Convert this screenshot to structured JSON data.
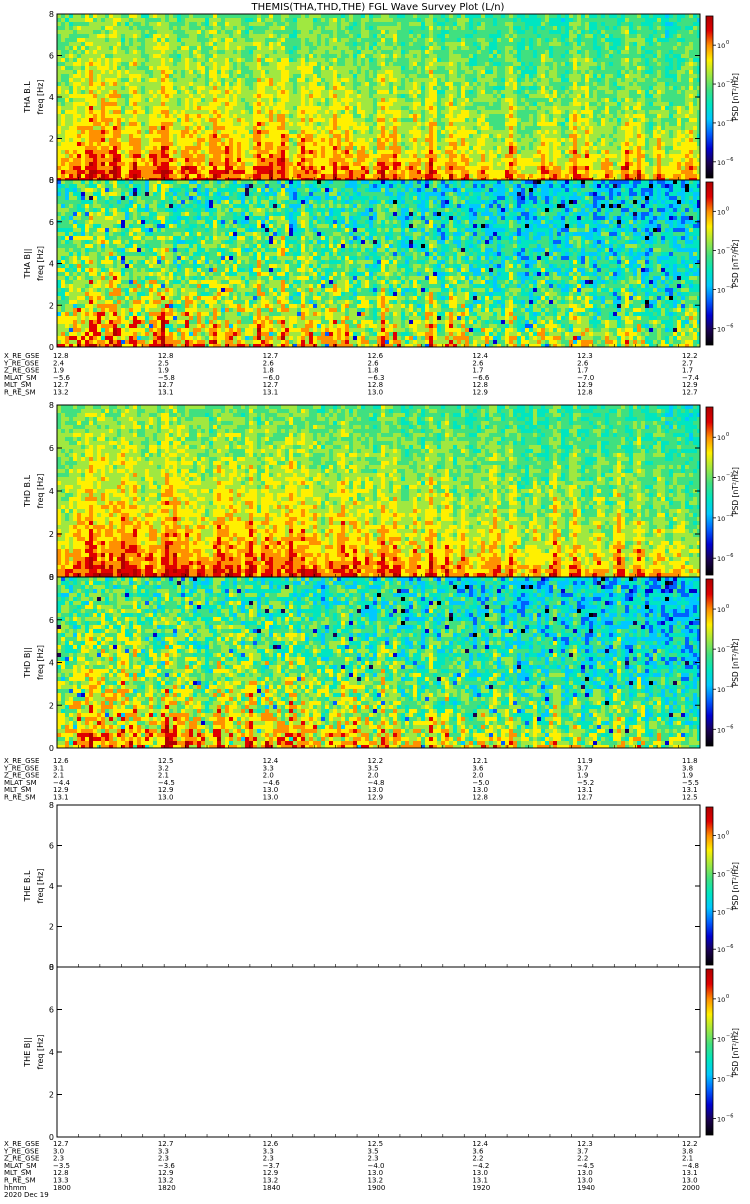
{
  "title": "THEMIS(THA,THD,THE) FGL Wave Survey Plot (L/n)",
  "cbar_tick_labels": [
    "10",
    "10",
    "10",
    "10"
  ],
  "cbar_tick_exps": [
    "0",
    "−2",
    "−4",
    "−6"
  ],
  "colors": {
    "colormap": [
      "#000000",
      "#1a0050",
      "#0000d0",
      "#0060ff",
      "#00c8ff",
      "#00e6c0",
      "#40e080",
      "#a0e840",
      "#fff000",
      "#ff9000",
      "#e00000",
      "#b00000"
    ]
  },
  "chart_data": [
    {
      "type": "heatmap",
      "probe": "THA",
      "component": "B.L",
      "ylabel": "THA B.L",
      "ysublabel": "freq [Hz]",
      "ylim": [
        0,
        8
      ],
      "yticks": [
        "0",
        "2",
        "4",
        "6",
        "8"
      ],
      "cbar_label": "PSD [nT²/Hz]",
      "has_data": true,
      "bands": [
        0.03,
        0.05,
        0.07,
        0.06,
        0.09,
        0.12,
        0.15,
        0.16,
        0.17,
        0.2,
        0.22,
        0.24,
        0.26,
        0.28,
        0.31,
        0.33,
        0.34,
        0.35,
        0.38,
        0.39,
        0.41,
        0.43,
        0.45,
        0.47,
        0.5,
        0.52,
        0.55,
        0.58,
        0.61,
        0.63,
        0.66,
        0.7,
        0.75,
        0.77,
        0.8,
        0.82,
        0.85,
        0.88,
        0.9,
        0.93,
        0.96,
        0.98
      ]
    },
    {
      "type": "heatmap",
      "probe": "THA",
      "component": "B||",
      "ylabel": "THA B||",
      "ysublabel": "freq [Hz]",
      "ylim": [
        0,
        8
      ],
      "yticks": [
        "0",
        "2",
        "4",
        "6",
        "8"
      ],
      "cbar_label": "PSD [nT²/Hz]",
      "has_data": true,
      "bands": [
        0.03,
        0.05,
        0.07,
        0.06,
        0.09,
        0.12,
        0.15,
        0.16,
        0.17,
        0.2,
        0.22,
        0.24,
        0.26,
        0.28,
        0.31,
        0.33,
        0.34,
        0.35,
        0.38,
        0.39,
        0.41,
        0.43,
        0.45,
        0.47,
        0.5,
        0.52,
        0.55,
        0.58,
        0.61,
        0.63,
        0.66,
        0.7,
        0.75,
        0.77,
        0.8,
        0.82,
        0.85,
        0.88,
        0.9,
        0.93,
        0.96,
        0.98
      ]
    },
    {
      "type": "heatmap",
      "probe": "THD",
      "component": "B.L",
      "ylabel": "THD B.L",
      "ysublabel": "freq [Hz]",
      "ylim": [
        0,
        8
      ],
      "yticks": [
        "0",
        "2",
        "4",
        "6",
        "8"
      ],
      "cbar_label": "PSD [nT²/Hz]",
      "has_data": true,
      "bands": [
        0.03,
        0.05,
        0.07,
        0.08,
        0.1,
        0.12,
        0.14,
        0.17,
        0.18,
        0.2,
        0.22,
        0.25,
        0.27,
        0.28,
        0.3,
        0.32,
        0.34,
        0.36,
        0.38,
        0.4,
        0.42,
        0.44,
        0.46,
        0.48,
        0.5,
        0.52,
        0.55,
        0.58,
        0.6,
        0.63,
        0.66,
        0.68,
        0.7,
        0.74,
        0.77,
        0.8,
        0.84,
        0.87,
        0.9,
        0.93,
        0.96
      ]
    },
    {
      "type": "heatmap",
      "probe": "THD",
      "component": "B||",
      "ylabel": "THD B||",
      "ysublabel": "freq [Hz]",
      "ylim": [
        0,
        8
      ],
      "yticks": [
        "0",
        "2",
        "4",
        "6",
        "8"
      ],
      "cbar_label": "PSD [nT²/Hz]",
      "has_data": true,
      "bands": [
        0.03,
        0.05,
        0.07,
        0.08,
        0.1,
        0.12,
        0.14,
        0.17,
        0.18,
        0.2,
        0.22,
        0.25,
        0.27,
        0.28,
        0.3,
        0.32,
        0.34,
        0.36,
        0.38,
        0.4,
        0.42,
        0.44,
        0.46,
        0.48,
        0.5,
        0.52,
        0.55,
        0.58,
        0.6,
        0.63,
        0.66,
        0.68,
        0.7,
        0.74,
        0.77,
        0.8,
        0.84,
        0.87,
        0.9,
        0.93,
        0.96
      ]
    },
    {
      "type": "heatmap",
      "probe": "THE",
      "component": "B.L",
      "ylabel": "THE B.L",
      "ysublabel": "freq [Hz]",
      "ylim": [
        0,
        8
      ],
      "yticks": [
        "0",
        "2",
        "4",
        "6",
        "8"
      ],
      "cbar_label": "PSD [nT²/Hz]",
      "has_data": false,
      "bands": []
    },
    {
      "type": "heatmap",
      "probe": "THE",
      "component": "B||",
      "ylabel": "THE B||",
      "ysublabel": "freq [Hz]",
      "ylim": [
        0,
        8
      ],
      "yticks": [
        "0",
        "2",
        "4",
        "6",
        "8"
      ],
      "cbar_label": "PSD [nT²/Hz]",
      "has_data": false,
      "bands": []
    }
  ],
  "ephemeris_tables": [
    {
      "probe": "THA",
      "labels": [
        "X_RE_GSE",
        "Y_RE_GSE",
        "Z_RE_GSE",
        "MLAT_SM",
        "MLT_SM",
        "R_RE_SM"
      ],
      "rows": [
        [
          "12.8",
          "12.8",
          "12.7",
          "12.6",
          "12.4",
          "12.3",
          "12.2"
        ],
        [
          "2.4",
          "2.5",
          "2.6",
          "2.6",
          "2.6",
          "2.6",
          "2.7"
        ],
        [
          "1.9",
          "1.9",
          "1.8",
          "1.8",
          "1.7",
          "1.7",
          "1.7"
        ],
        [
          "−5.6",
          "−5.8",
          "−6.0",
          "−6.3",
          "−6.6",
          "−7.0",
          "−7.4"
        ],
        [
          "12.7",
          "12.7",
          "12.7",
          "12.8",
          "12.8",
          "12.9",
          "12.9"
        ],
        [
          "13.2",
          "13.1",
          "13.1",
          "13.0",
          "12.9",
          "12.8",
          "12.7"
        ]
      ]
    },
    {
      "probe": "THD",
      "labels": [
        "X_RE_GSE",
        "Y_RE_GSE",
        "Z_RE_GSE",
        "MLAT_SM",
        "MLT_SM",
        "R_RE_SM"
      ],
      "rows": [
        [
          "12.6",
          "12.5",
          "12.4",
          "12.2",
          "12.1",
          "11.9",
          "11.8"
        ],
        [
          "3.1",
          "3.2",
          "3.3",
          "3.5",
          "3.6",
          "3.7",
          "3.8"
        ],
        [
          "2.1",
          "2.1",
          "2.0",
          "2.0",
          "2.0",
          "1.9",
          "1.9"
        ],
        [
          "−4.4",
          "−4.5",
          "−4.6",
          "−4.8",
          "−5.0",
          "−5.2",
          "−5.5"
        ],
        [
          "12.9",
          "12.9",
          "13.0",
          "13.0",
          "13.0",
          "13.1",
          "13.1"
        ],
        [
          "13.1",
          "13.0",
          "13.0",
          "12.9",
          "12.8",
          "12.7",
          "12.5"
        ]
      ]
    },
    {
      "probe": "THE",
      "labels": [
        "X_RE_GSE",
        "Y_RE_GSE",
        "Z_RE_GSE",
        "MLAT_SM",
        "MLT_SM",
        "R_RE_SM",
        "hhmm",
        "2020 Dec 19"
      ],
      "rows": [
        [
          "12.7",
          "12.7",
          "12.6",
          "12.5",
          "12.4",
          "12.3",
          "12.2"
        ],
        [
          "3.0",
          "3.3",
          "3.3",
          "3.5",
          "3.6",
          "3.7",
          "3.8"
        ],
        [
          "2.3",
          "2.3",
          "2.3",
          "2.3",
          "2.2",
          "2.2",
          "2.1"
        ],
        [
          "−3.5",
          "−3.6",
          "−3.7",
          "−4.0",
          "−4.2",
          "−4.5",
          "−4.8"
        ],
        [
          "12.8",
          "12.9",
          "12.9",
          "13.0",
          "13.0",
          "13.0",
          "13.1"
        ],
        [
          "13.3",
          "13.2",
          "13.2",
          "13.2",
          "13.1",
          "13.0",
          "13.0"
        ],
        [
          "1800",
          "1820",
          "1840",
          "1900",
          "1920",
          "1940",
          "2000"
        ],
        [
          "",
          "",
          "",
          "",
          "",
          "",
          ""
        ]
      ]
    }
  ]
}
